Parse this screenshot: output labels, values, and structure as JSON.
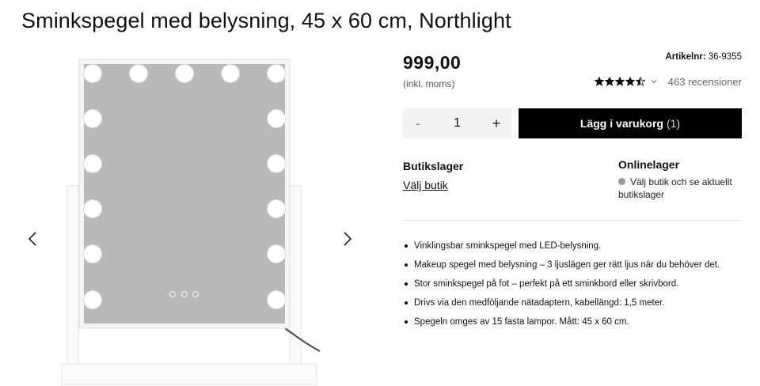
{
  "product": {
    "title": "Sminkspegel med belysning, 45 x 60 cm, Northlight",
    "price": "999,00",
    "vat_note": "(inkl. moms)",
    "sku_label": "Artikelnr:",
    "sku_value": "36-9355",
    "rating_value": 4.5,
    "rating_max": 5,
    "reviews": "463 recensioner"
  },
  "gallery": {
    "prev_icon": "chevron-left-icon",
    "next_icon": "chevron-right-icon"
  },
  "cart": {
    "minus": "-",
    "quantity": "1",
    "plus": "+",
    "add_label": "Lägg i varukorg",
    "add_count": "(1)"
  },
  "stock": {
    "store_heading": "Butikslager",
    "store_link": "Välj butik",
    "online_heading": "Onlinelager",
    "online_status": "Välj butik och se aktuellt butikslager",
    "status_color": "#9a9a9a"
  },
  "features": [
    "Vinklingsbar sminkspegel med LED-belysning.",
    "Makeup spegel med belysning – 3 ljuslägen ger rätt ljus när du behöver det.",
    "Stor sminkspegel på fot – perfekt på ett sminkbord eller skrivbord.",
    "Drivs via den medföljande nätadaptern, kabellängd: 1,5 meter.",
    "Spegeln omges av 15 fasta lampor. Mått: 45 x 60 cm."
  ]
}
